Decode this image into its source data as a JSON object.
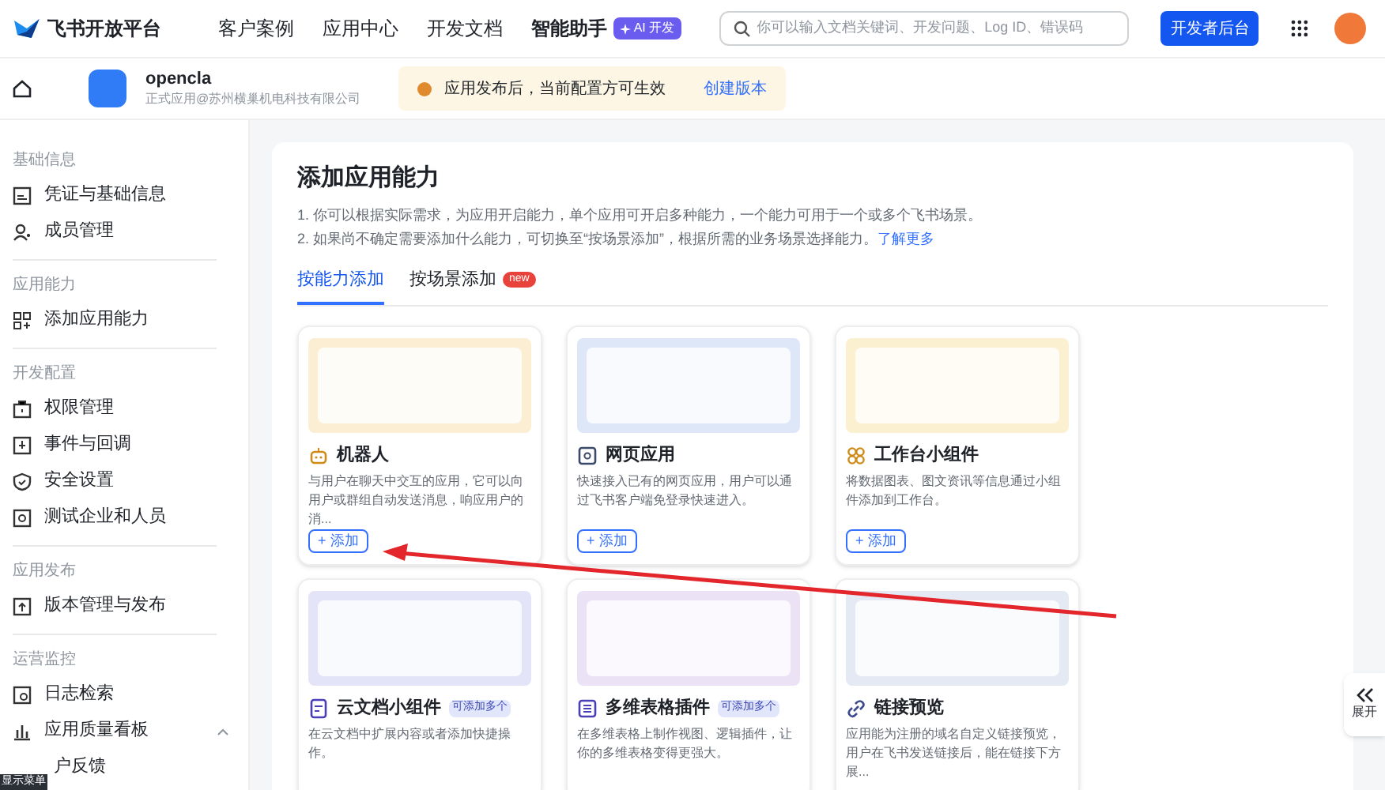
{
  "header": {
    "logo_text": "飞书开放平台",
    "nav": [
      "客户案例",
      "应用中心",
      "开发文档",
      "智能助手"
    ],
    "ai_badge": "AI 开发",
    "search": {
      "placeholder": "你可以输入文档关键词、开发问题、Log ID、错误码"
    },
    "dev_button": "开发者后台"
  },
  "app_bar": {
    "app_name": "opencla",
    "company": "正式应用@苏州横巢机电科技有限公司",
    "notice": "应用发布后，当前配置方可生效",
    "notice_link": "创建版本"
  },
  "sidebar": {
    "sections": [
      {
        "title": "基础信息",
        "items": [
          {
            "label": "凭证与基础信息",
            "kind": "link"
          },
          {
            "label": "成员管理",
            "kind": "link"
          }
        ]
      },
      {
        "title": "应用能力",
        "items": [
          {
            "label": "添加应用能力",
            "kind": "link"
          }
        ]
      },
      {
        "title": "开发配置",
        "items": [
          {
            "label": "权限管理",
            "kind": "link"
          },
          {
            "label": "事件与回调",
            "kind": "link"
          },
          {
            "label": "安全设置",
            "kind": "link"
          },
          {
            "label": "测试企业和人员",
            "kind": "link"
          }
        ]
      },
      {
        "title": "应用发布",
        "items": [
          {
            "label": "版本管理与发布",
            "kind": "link"
          }
        ]
      },
      {
        "title": "运营监控",
        "items": [
          {
            "label": "日志检索",
            "kind": "link"
          },
          {
            "label": "应用质量看板",
            "kind": "group",
            "expanded": true
          },
          {
            "label": "户反馈",
            "kind": "link"
          }
        ]
      }
    ]
  },
  "menu_tip": "显示菜单",
  "main": {
    "title": "添加应用能力",
    "notes": [
      "1. 你可以根据实际需求，为应用开启能力，单个应用可开启多种能力，一个能力可用于一个或多个飞书场景。",
      "2. 如果尚不确定需要添加什么能力，可切换至“按场景添加”，根据所需的业务场景选择能力。"
    ],
    "notes_link": "了解更多",
    "tabs": [
      {
        "label": "按能力添加",
        "selected": true
      },
      {
        "label": "按场景添加",
        "selected": false,
        "badge": "new"
      }
    ],
    "cards": [
      {
        "kind": "robot",
        "title": "机器人",
        "desc": "与用户在聊天中交互的应用，它可以向用户或群组自动发送消息，响应用户的消...",
        "button": "+ 添加"
      },
      {
        "kind": "web",
        "title": "网页应用",
        "desc": "快速接入已有的网页应用，用户可以通过飞书客户端免登录快速进入。",
        "button": "+ 添加"
      },
      {
        "kind": "widget",
        "title": "工作台小组件",
        "desc": "将数据图表、图文资讯等信息通过小组件添加到工作台。",
        "button": "+ 添加"
      },
      {
        "kind": "doc",
        "title": "云文档小组件",
        "tag": "可添加多个",
        "desc": "在云文档中扩展内容或者添加快捷操作。"
      },
      {
        "kind": "table",
        "title": "多维表格插件",
        "tag": "可添加多个",
        "desc": "在多维表格上制作视图、逻辑插件，让你的多维表格变得更强大。"
      },
      {
        "kind": "link",
        "title": "链接预览",
        "desc": "应用能为注册的域名自定义链接预览，用户在飞书发送链接后，能在链接下方展..."
      }
    ]
  },
  "expand_button": {
    "label": "展开"
  }
}
